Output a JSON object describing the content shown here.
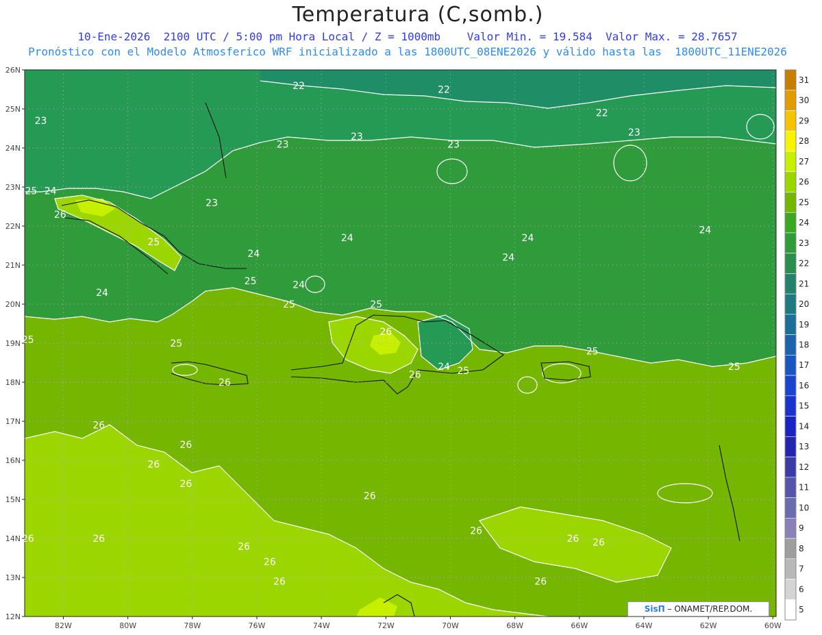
{
  "title": "Temperatura (C,somb.)",
  "subtitle_1": "10-Ene-2026  2100 UTC / 5:00 pm Hora Local / Z = 1000mb    Valor Min. = 19.584  Valor Max. = 28.7657",
  "subtitle_2": "Pronóstico con el Modelo Atmosferico WRF inicializado a las 1800UTC_08ENE2026 y válido hasta las  1800UTC_11ENE2026",
  "credit": {
    "logo": "SisΠ",
    "text": " – ONAMET/REP.DOM."
  },
  "axes": {
    "lat_labels": [
      "26N",
      "25N",
      "24N",
      "23N",
      "22N",
      "21N",
      "20N",
      "19N",
      "18N",
      "17N",
      "16N",
      "15N",
      "14N",
      "13N",
      "12N"
    ],
    "lon_labels": [
      "82W",
      "80W",
      "78W",
      "76W",
      "74W",
      "72W",
      "70W",
      "68W",
      "66W",
      "64W",
      "62W",
      "60W"
    ]
  },
  "colorbar": {
    "labels": [
      "31",
      "30",
      "29",
      "28",
      "27",
      "26",
      "25",
      "24",
      "23",
      "22",
      "21",
      "20",
      "19",
      "18",
      "17",
      "16",
      "15",
      "14",
      "13",
      "12",
      "11",
      "10",
      "9",
      "8",
      "7",
      "6",
      "5"
    ],
    "colors": [
      "#c87f00",
      "#e09c00",
      "#f5c400",
      "#f8f400",
      "#c6f000",
      "#9cd600",
      "#74b600",
      "#3aa820",
      "#2f9b3a",
      "#2a8e4e",
      "#22826a",
      "#1d7a80",
      "#1a7096",
      "#1a64ad",
      "#1a55c4",
      "#1a44cf",
      "#1a33cf",
      "#1a23c6",
      "#2424b0",
      "#3a3aa8",
      "#5555aa",
      "#6b6bb0",
      "#8c80b8",
      "#9e9e9e",
      "#b8b8b8",
      "#d4d4d4",
      "#ffffff"
    ]
  },
  "map_colors": {
    "t26": "#9cd600",
    "t25": "#74b600",
    "t24": "#2f9b3a",
    "t23": "#259a55",
    "t22": "#1f8e66",
    "t27": "#c6f000"
  },
  "contour_labels": [
    {
      "text": "22",
      "lon": -74.7,
      "lat": 25.6
    },
    {
      "text": "22",
      "lon": -70.2,
      "lat": 25.5
    },
    {
      "text": "22",
      "lon": -65.3,
      "lat": 24.9
    },
    {
      "text": "23",
      "lon": -82.7,
      "lat": 24.7
    },
    {
      "text": "23",
      "lon": -75.2,
      "lat": 24.1
    },
    {
      "text": "23",
      "lon": -72.9,
      "lat": 24.3
    },
    {
      "text": "23",
      "lon": -69.9,
      "lat": 24.1
    },
    {
      "text": "23",
      "lon": -64.3,
      "lat": 24.4
    },
    {
      "text": "23",
      "lon": -77.4,
      "lat": 22.6
    },
    {
      "text": "25",
      "lon": -83.0,
      "lat": 22.9
    },
    {
      "text": "24",
      "lon": -82.4,
      "lat": 22.9
    },
    {
      "text": "26",
      "lon": -82.1,
      "lat": 22.3
    },
    {
      "text": "25",
      "lon": -79.2,
      "lat": 21.6
    },
    {
      "text": "24",
      "lon": -76.1,
      "lat": 21.3
    },
    {
      "text": "25",
      "lon": -76.2,
      "lat": 20.6
    },
    {
      "text": "24",
      "lon": -80.8,
      "lat": 20.3
    },
    {
      "text": "24",
      "lon": -74.7,
      "lat": 20.5
    },
    {
      "text": "25",
      "lon": -75.0,
      "lat": 20.0
    },
    {
      "text": "24",
      "lon": -73.2,
      "lat": 21.7
    },
    {
      "text": "24",
      "lon": -67.6,
      "lat": 21.7
    },
    {
      "text": "24",
      "lon": -68.2,
      "lat": 21.2
    },
    {
      "text": "24",
      "lon": -62.1,
      "lat": 21.9
    },
    {
      "text": "25",
      "lon": -83.1,
      "lat": 19.1
    },
    {
      "text": "25",
      "lon": -78.5,
      "lat": 19.0
    },
    {
      "text": "25",
      "lon": -72.3,
      "lat": 20.0
    },
    {
      "text": "26",
      "lon": -72.0,
      "lat": 19.3
    },
    {
      "text": "26",
      "lon": -77.0,
      "lat": 18.0
    },
    {
      "text": "26",
      "lon": -71.1,
      "lat": 18.2
    },
    {
      "text": "24",
      "lon": -70.2,
      "lat": 18.4
    },
    {
      "text": "25",
      "lon": -69.6,
      "lat": 18.3
    },
    {
      "text": "25",
      "lon": -65.6,
      "lat": 18.8
    },
    {
      "text": "25",
      "lon": -61.2,
      "lat": 18.4
    },
    {
      "text": "26",
      "lon": -80.9,
      "lat": 16.9
    },
    {
      "text": "26",
      "lon": -78.2,
      "lat": 16.4
    },
    {
      "text": "26",
      "lon": -79.2,
      "lat": 15.9
    },
    {
      "text": "26",
      "lon": -78.2,
      "lat": 15.4
    },
    {
      "text": "26",
      "lon": -72.5,
      "lat": 15.1
    },
    {
      "text": "26",
      "lon": -83.1,
      "lat": 14.0
    },
    {
      "text": "26",
      "lon": -80.9,
      "lat": 14.0
    },
    {
      "text": "26",
      "lon": -76.4,
      "lat": 13.8
    },
    {
      "text": "26",
      "lon": -75.6,
      "lat": 13.4
    },
    {
      "text": "26",
      "lon": -69.2,
      "lat": 14.2
    },
    {
      "text": "26",
      "lon": -66.2,
      "lat": 14.0
    },
    {
      "text": "26",
      "lon": -65.4,
      "lat": 13.9
    },
    {
      "text": "26",
      "lon": -67.2,
      "lat": 12.9
    },
    {
      "text": "26",
      "lon": -75.3,
      "lat": 12.9
    }
  ]
}
